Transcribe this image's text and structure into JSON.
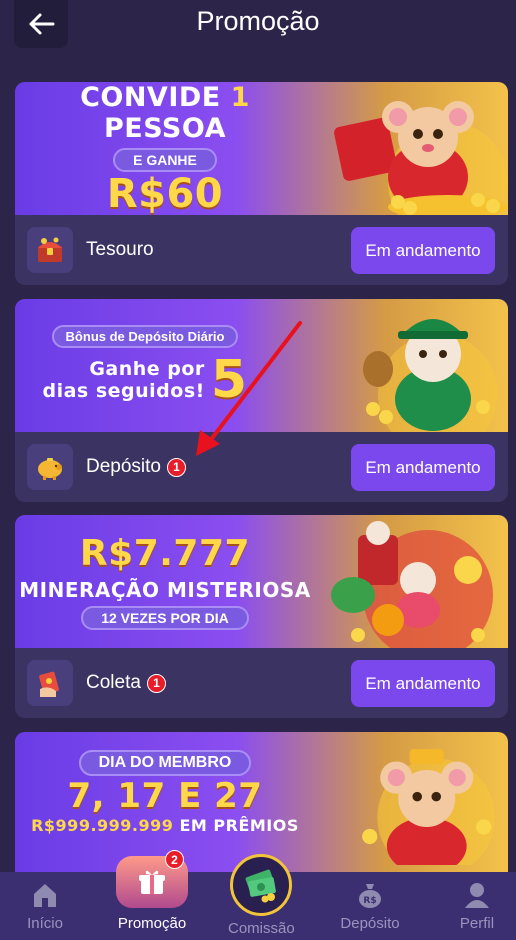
{
  "header": {
    "title": "Promoção",
    "back_icon": "arrow-left-icon"
  },
  "promotions": [
    {
      "banner_lines": [
        "CONVIDE",
        "1",
        "PESSOA",
        "E GANHE",
        "R$60"
      ],
      "label": "Tesouro",
      "badge": "",
      "status": "Em andamento",
      "icon": "treasure-chest-icon"
    },
    {
      "banner_lines": [
        "Bônus de Depósito Diário",
        "Ganhe por",
        "dias seguidos!",
        "5"
      ],
      "label": "Depósito",
      "badge": "1",
      "status": "Em andamento",
      "icon": "piggy-bank-icon"
    },
    {
      "banner_lines": [
        "R$7.777",
        "MINERAÇÃO MISTERIOSA",
        "12 VEZES POR DIA"
      ],
      "label": "Coleta",
      "badge": "1",
      "status": "Em andamento",
      "icon": "red-envelope-icon"
    },
    {
      "banner_lines": [
        "DIA DO MEMBRO",
        "7, 17 E 27",
        "R$999.999.999",
        "EM PRÊMIOS"
      ]
    }
  ],
  "nav": {
    "items": [
      {
        "label": "Início",
        "icon": "home-icon",
        "active": false
      },
      {
        "label": "Promoção",
        "icon": "gift-icon",
        "active": true,
        "badge": "2"
      },
      {
        "label": "Comissão",
        "icon": "money-stack-icon",
        "active": false
      },
      {
        "label": "Depósito",
        "icon": "money-bag-icon",
        "active": false
      },
      {
        "label": "Perfil",
        "icon": "user-icon",
        "active": false
      }
    ]
  },
  "colors": {
    "background": "#2c2549",
    "card": "#3b3463",
    "button": "#7b48ee",
    "badge": "#e81d2a",
    "nav": "#3b2f72",
    "gold": "#ffd84a"
  }
}
